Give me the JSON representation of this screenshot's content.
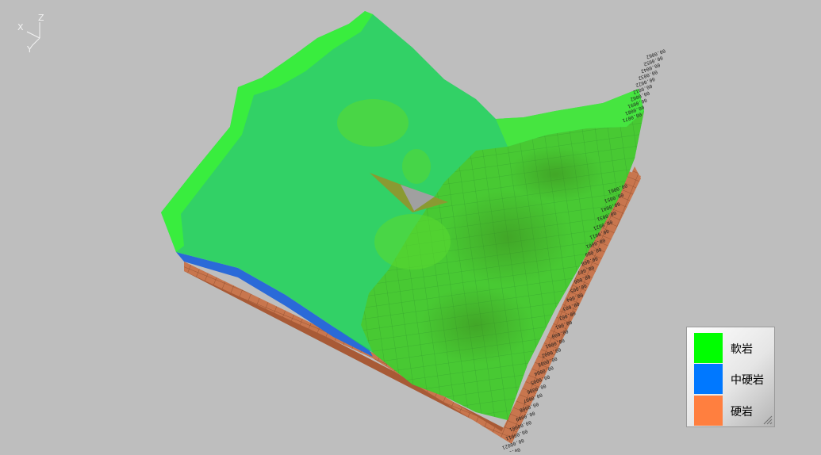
{
  "axis_gizmo": {
    "x": "X",
    "y": "Y",
    "z": "Z"
  },
  "legend": {
    "items": [
      {
        "label": "軟岩",
        "color": "#00ff00"
      },
      {
        "label": "中硬岩",
        "color": "#0078ff"
      },
      {
        "label": "硬岩",
        "color": "#ff7f3f"
      }
    ]
  },
  "scale_ticks": [
    "00.0062",
    "00.0052",
    "00.0042",
    "00.0032",
    "00.0022",
    "00.0012",
    "00.0002",
    "00.0091",
    "00.0081",
    "00.0071",
    "00.0061",
    "00.0051",
    "00.0041",
    "00.0031",
    "00.0021",
    "00.0011",
    "00.0001",
    "00.009",
    "00.008",
    "00.007",
    "00.006",
    "00.005",
    "00.004",
    "00.003",
    "00.002",
    "00.001",
    "00.000",
    "00.0001",
    "00.0002",
    "00.0003",
    "00.0004",
    "00.0005",
    "00.0006",
    "00.0007",
    "00.0008",
    "00.0009",
    "00.00001",
    "00.00011",
    "00.00021",
    "00.00031"
  ],
  "colors": {
    "background": "#bebebe",
    "soft_rock": "#00ff00",
    "medium_rock": "#0078ff",
    "hard_rock": "#ff7f3f"
  }
}
